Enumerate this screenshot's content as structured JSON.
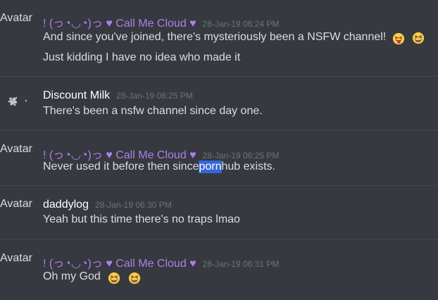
{
  "messages": [
    {
      "avatar_label": "Avatar",
      "username": "! (っ◔◡◔)っ ♥ Call Me Cloud ♥",
      "timestamp": "28-Jan-19 06:24 PM",
      "lines": [
        {
          "text": "And since you've joined, there's mysteriously been a NSFW channel!",
          "emojis": [
            "tongue-wink-emoji",
            "grinning-squint-emoji"
          ]
        },
        {
          "text": "Just kidding I have no idea who made it"
        }
      ]
    },
    {
      "avatar_label": "",
      "username": "Discount Milk",
      "timestamp": "28-Jan-19 06:25 PM",
      "lines": [
        {
          "text": "There's been a nsfw channel since day one."
        }
      ]
    },
    {
      "avatar_label": "Avatar",
      "username": "! (っ◔◡◔)っ ♥ Call Me Cloud ♥",
      "timestamp": "28-Jan-19 06:25 PM",
      "lines": [
        {
          "text_before": "Never used it before then since ",
          "highlight": "porn",
          "text_after": "hub exists."
        }
      ]
    },
    {
      "avatar_label": "Avatar",
      "username": "daddylog",
      "timestamp": "28-Jan-19 06:30 PM",
      "lines": [
        {
          "text": "Yeah but this time there's no traps lmao"
        }
      ]
    },
    {
      "avatar_label": "Avatar",
      "username": "! (っ◔◡◔)っ ♥ Call Me Cloud ♥",
      "timestamp": "28-Jan-19 06:31 PM",
      "lines": [
        {
          "text": "Oh my God",
          "emojis": [
            "grinning-squint-emoji",
            "grinning-squint-emoji"
          ]
        }
      ]
    }
  ],
  "colors": {
    "background": "#36393f",
    "username_purple": "#b07ee8",
    "username_white": "#ffffff",
    "timestamp": "#6f7278",
    "text": "#dcddde",
    "highlight": "#3367d6"
  }
}
